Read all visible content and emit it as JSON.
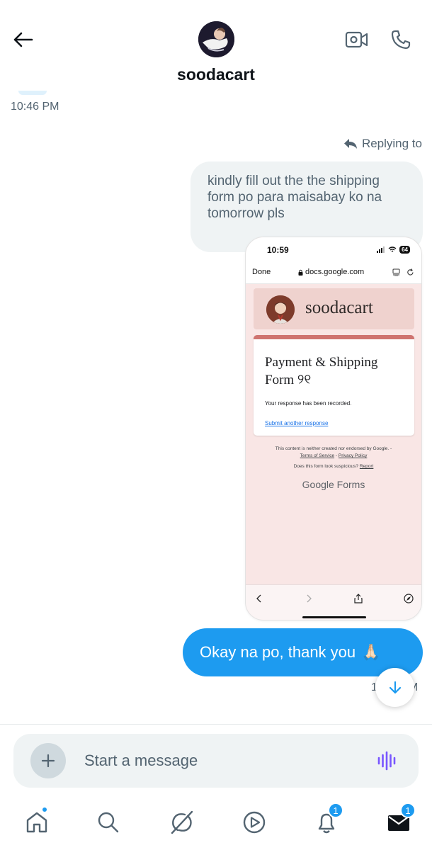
{
  "header": {
    "title": "soodacart",
    "icons": [
      "back-arrow-icon",
      "video-call-icon",
      "phone-call-icon"
    ]
  },
  "conversation": {
    "time_top": "10:46 PM",
    "replying_label": "Replying to",
    "quoted_text": "kindly fill out the the shipping form po para maisabay ko na tomorrow pls",
    "sent_text": "Okay na po, thank you",
    "sent_emoji": "🙏🏻",
    "time_bottom": "1",
    "time_bottom_tail": "M"
  },
  "screenshot": {
    "status_time": "10:59",
    "battery": "64",
    "done_label": "Done",
    "url": "docs.google.com",
    "banner_name": "soodacart",
    "form_title": "Payment & Shipping Form ୨୧",
    "response_msg": "Your response has been recorded.",
    "submit_another": "Submit another response",
    "fine_print_1": "This content is neither created nor endorsed by Google. -",
    "terms": "Terms of Service",
    "privacy": "Privacy Policy",
    "suspicious": "Does this form look suspicious?",
    "report": "Report",
    "google_forms": "Google Forms"
  },
  "composer": {
    "placeholder": "Start a message"
  },
  "nav": {
    "items": [
      "home-icon",
      "search-icon",
      "grok-icon",
      "video-icon",
      "notifications-icon",
      "messages-icon"
    ],
    "notifications_count": "1",
    "messages_count": "1"
  },
  "colors": {
    "accent": "#1d9bf0",
    "bubble_gray": "#eff3f4",
    "text_secondary": "#536471",
    "voice_purple": "#7856ff"
  }
}
